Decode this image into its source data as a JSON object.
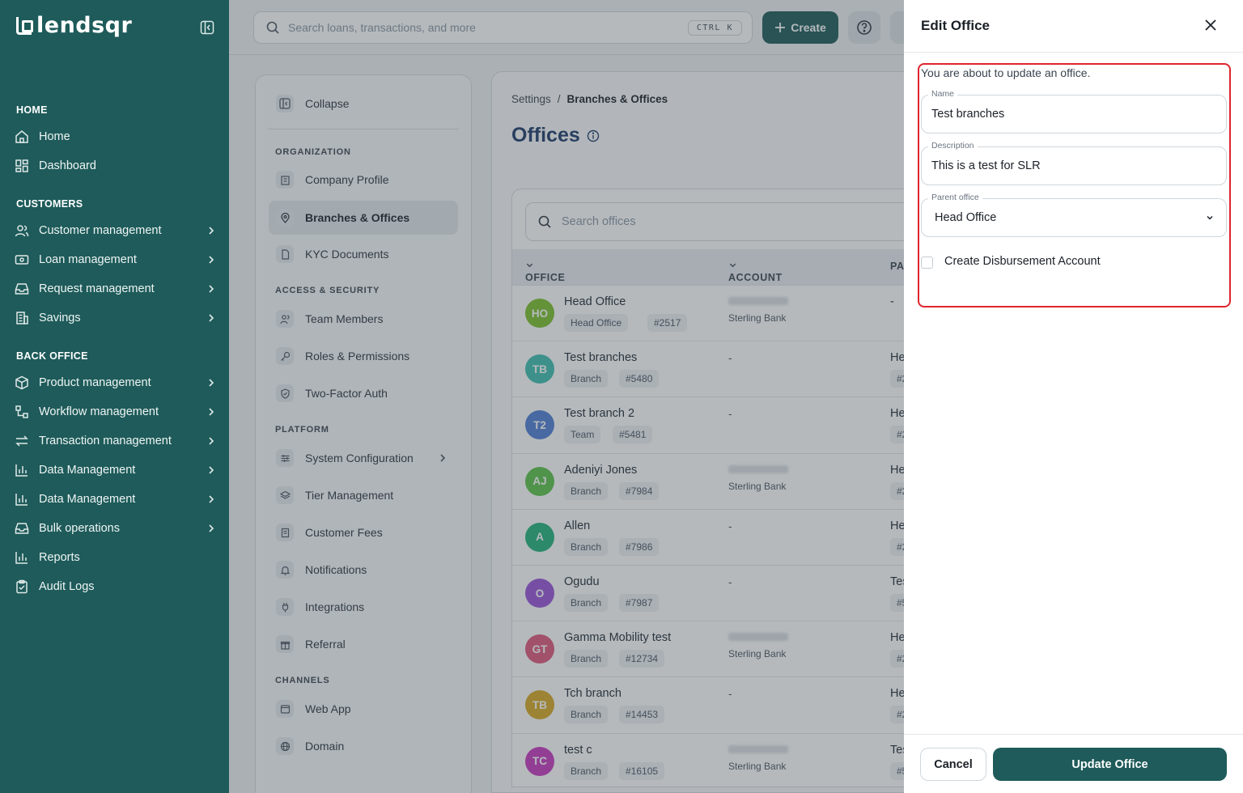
{
  "brand": {
    "name": "lendsqr"
  },
  "sidebar": {
    "sections": [
      {
        "title": "HOME"
      },
      {
        "title": "CUSTOMERS"
      },
      {
        "title": "BACK OFFICE"
      }
    ],
    "items": [
      {
        "label": "Home",
        "icon": "home-icon"
      },
      {
        "label": "Dashboard",
        "icon": "dashboard-icon"
      },
      {
        "label": "Customer management",
        "icon": "users-icon"
      },
      {
        "label": "Loan management",
        "icon": "loan-icon"
      },
      {
        "label": "Request management",
        "icon": "inbox-icon"
      },
      {
        "label": "Savings",
        "icon": "savings-icon"
      },
      {
        "label": "Product management",
        "icon": "box-icon"
      },
      {
        "label": "Workflow management",
        "icon": "workflow-icon"
      },
      {
        "label": "Transaction management",
        "icon": "transfer-icon"
      },
      {
        "label": "Data Management",
        "icon": "chart-icon"
      },
      {
        "label": "Data Management",
        "icon": "chart-icon"
      },
      {
        "label": "Bulk operations",
        "icon": "inbox-icon"
      },
      {
        "label": "Reports",
        "icon": "chart-icon"
      },
      {
        "label": "Audit Logs",
        "icon": "clipboard-icon"
      }
    ]
  },
  "topbar": {
    "search_placeholder": "Search loans, transactions, and more",
    "shortcut": "CTRL K",
    "create_label": "Create"
  },
  "settings_nav": {
    "collapse_label": "Collapse",
    "sections": [
      "ORGANIZATION",
      "ACCESS & SECURITY",
      "PLATFORM",
      "CHANNELS"
    ],
    "items": [
      {
        "label": "Company Profile"
      },
      {
        "label": "Branches & Offices"
      },
      {
        "label": "KYC Documents"
      },
      {
        "label": "Team Members"
      },
      {
        "label": "Roles & Permissions"
      },
      {
        "label": "Two-Factor Auth"
      },
      {
        "label": "System Configuration"
      },
      {
        "label": "Tier Management"
      },
      {
        "label": "Customer Fees"
      },
      {
        "label": "Notifications"
      },
      {
        "label": "Integrations"
      },
      {
        "label": "Referral"
      },
      {
        "label": "Web App"
      },
      {
        "label": "Domain"
      }
    ]
  },
  "breadcrumb": {
    "root": "Settings",
    "separator": "/",
    "current": "Branches & Offices"
  },
  "page": {
    "title": "Offices"
  },
  "offices_table": {
    "search_placeholder": "Search offices",
    "columns": [
      "OFFICE",
      "ACCOUNT",
      "PA"
    ],
    "rows": [
      {
        "initials": "HO",
        "color": "#7cc02a",
        "name": "Head Office",
        "type": "Head Office",
        "id": "#2517",
        "bank": "Sterling Bank",
        "parent": "-",
        "parent_tag": ""
      },
      {
        "initials": "TB",
        "color": "#3fbfb0",
        "name": "Test branches",
        "type": "Branch",
        "id": "#5480",
        "bank": "",
        "parent": "He",
        "parent_tag": "#2"
      },
      {
        "initials": "T2",
        "color": "#4f7fd4",
        "name": "Test branch 2",
        "type": "Team",
        "id": "#5481",
        "bank": "",
        "parent": "He",
        "parent_tag": "#2"
      },
      {
        "initials": "AJ",
        "color": "#5cc24a",
        "name": "Adeniyi Jones",
        "type": "Branch",
        "id": "#7984",
        "bank": "Sterling Bank",
        "parent": "He",
        "parent_tag": "#2"
      },
      {
        "initials": "A",
        "color": "#22b27a",
        "name": "Allen",
        "type": "Branch",
        "id": "#7986",
        "bank": "",
        "parent": "He",
        "parent_tag": "#2"
      },
      {
        "initials": "O",
        "color": "#9a55d8",
        "name": "Ogudu",
        "type": "Branch",
        "id": "#7987",
        "bank": "",
        "parent": "Tes",
        "parent_tag": "#5"
      },
      {
        "initials": "GT",
        "color": "#e0577c",
        "name": "Gamma Mobility test",
        "type": "Branch",
        "id": "#12734",
        "bank": "Sterling Bank",
        "parent": "He",
        "parent_tag": "#2"
      },
      {
        "initials": "TB",
        "color": "#d9a825",
        "name": "Tch branch",
        "type": "Branch",
        "id": "#14453",
        "bank": "",
        "parent": "He",
        "parent_tag": "#2"
      },
      {
        "initials": "TC",
        "color": "#c839c0",
        "name": "test c",
        "type": "Branch",
        "id": "#16105",
        "bank": "Sterling Bank",
        "parent": "Tes",
        "parent_tag": "#5"
      }
    ]
  },
  "drawer": {
    "title": "Edit Office",
    "intro": "You are about to update an office.",
    "name_label": "Name",
    "name_value": "Test branches",
    "description_label": "Description",
    "description_value": "This is a test for SLR",
    "parent_label": "Parent office",
    "parent_value": "Head Office",
    "checkbox_label": "Create Disbursement Account",
    "cancel_label": "Cancel",
    "update_label": "Update Office",
    "highlight_color": "#e0242e"
  }
}
